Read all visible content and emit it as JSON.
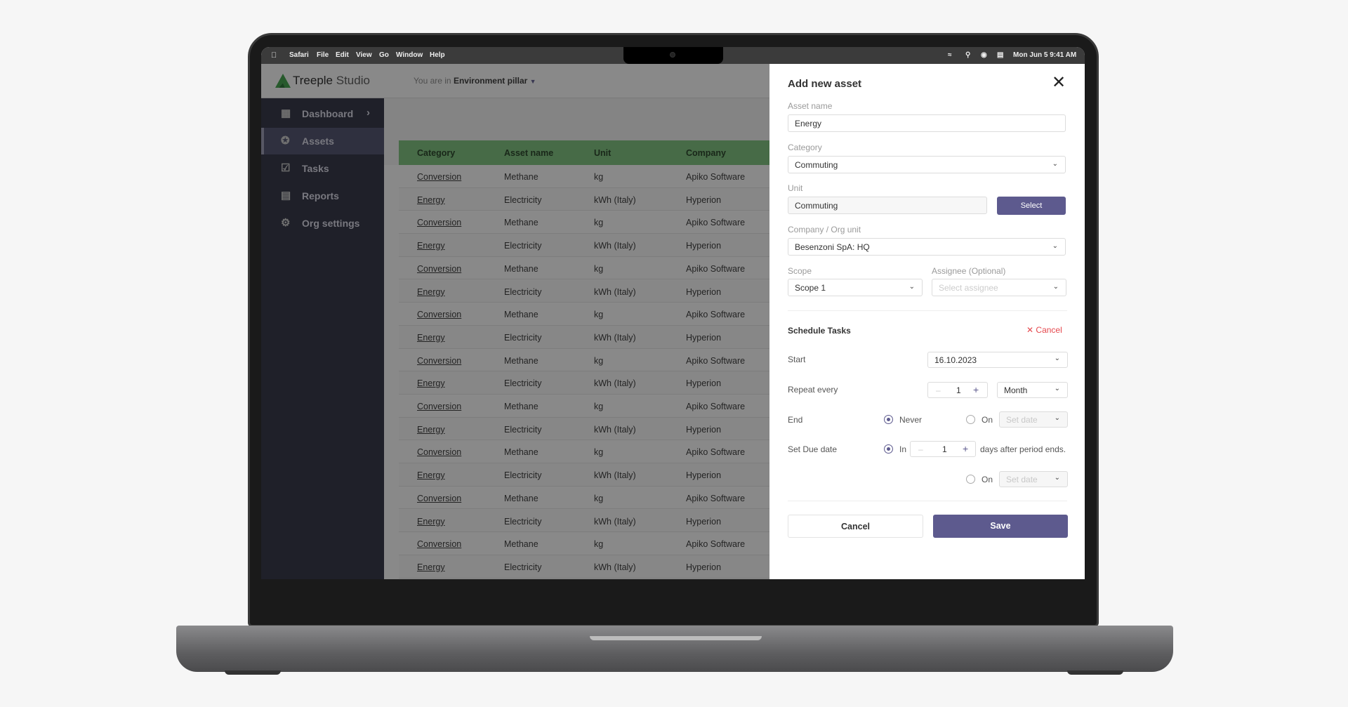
{
  "menubar": {
    "apple": "",
    "items": [
      "Safari",
      "File",
      "Edit",
      "View",
      "Go",
      "Window",
      "Help"
    ],
    "clock": "Mon Jun 5  9:41 AM"
  },
  "app": {
    "logo": "Treeple",
    "logo_suffix": "Studio",
    "context_prefix": "You are in",
    "context": "Environment pillar",
    "brand_color": "#3aa045"
  },
  "sidebar": {
    "items": [
      {
        "label": "Dashboard",
        "icon": "dashboard-icon"
      },
      {
        "label": "Assets",
        "icon": "plug-icon"
      },
      {
        "label": "Tasks",
        "icon": "clipboard-check-icon"
      },
      {
        "label": "Reports",
        "icon": "document-icon"
      },
      {
        "label": "Org settings",
        "icon": "gear-icon"
      }
    ],
    "active": "Assets"
  },
  "table": {
    "headers": [
      "Category",
      "Asset name",
      "Unit",
      "Company"
    ],
    "rows": [
      [
        "Conversion",
        "Methane",
        "kg",
        "Apiko Software"
      ],
      [
        "Energy",
        "Electricity",
        "kWh (Italy)",
        "Hyperion"
      ],
      [
        "Conversion",
        "Methane",
        "kg",
        "Apiko Software"
      ],
      [
        "Energy",
        "Electricity",
        "kWh (Italy)",
        "Hyperion"
      ],
      [
        "Conversion",
        "Methane",
        "kg",
        "Apiko Software"
      ],
      [
        "Energy",
        "Electricity",
        "kWh (Italy)",
        "Hyperion"
      ],
      [
        "Conversion",
        "Methane",
        "kg",
        "Apiko Software"
      ],
      [
        "Energy",
        "Electricity",
        "kWh (Italy)",
        "Hyperion"
      ],
      [
        "Conversion",
        "Methane",
        "kg",
        "Apiko Software"
      ],
      [
        "Energy",
        "Electricity",
        "kWh (Italy)",
        "Hyperion"
      ],
      [
        "Conversion",
        "Methane",
        "kg",
        "Apiko Software"
      ],
      [
        "Energy",
        "Electricity",
        "kWh (Italy)",
        "Hyperion"
      ],
      [
        "Conversion",
        "Methane",
        "kg",
        "Apiko Software"
      ],
      [
        "Energy",
        "Electricity",
        "kWh (Italy)",
        "Hyperion"
      ],
      [
        "Conversion",
        "Methane",
        "kg",
        "Apiko Software"
      ],
      [
        "Energy",
        "Electricity",
        "kWh (Italy)",
        "Hyperion"
      ],
      [
        "Conversion",
        "Methane",
        "kg",
        "Apiko Software"
      ],
      [
        "Energy",
        "Electricity",
        "kWh (Italy)",
        "Hyperion"
      ]
    ]
  },
  "dialog": {
    "title": "Add new asset",
    "asset_name_label": "Asset name",
    "asset_name_value": "Energy",
    "category_label": "Category",
    "category_value": "Commuting",
    "unit_label": "Unit",
    "unit_value": "Commuting",
    "select_button": "Select",
    "company_label": "Company / Org unit",
    "company_value": "Besenzoni SpA: HQ",
    "scope_label": "Scope",
    "scope_value": "Scope 1",
    "assignee_label": "Assignee (Optional)",
    "assignee_placeholder": "Select assignee",
    "schedule": {
      "title": "Schedule Tasks",
      "cancel": "Cancel",
      "start_label": "Start",
      "start_value": "16.10.2023",
      "repeat_label": "Repeat every",
      "repeat_value": "1",
      "repeat_unit": "Month",
      "end_label": "End",
      "end_never": "Never",
      "end_on": "On",
      "end_date_placeholder": "Set date",
      "end_selected": "Never",
      "due_label": "Set Due date",
      "due_in": "In",
      "due_value": "1",
      "due_suffix": "days after period ends.",
      "due_on": "On",
      "due_date_placeholder": "Set date",
      "due_selected": "In"
    },
    "cancel_button": "Cancel",
    "save_button": "Save"
  },
  "colors": {
    "primary": "#5d5a8e",
    "danger": "#e5484d",
    "table_header": "#7ac27a",
    "sidebar": "#2b2c3f"
  }
}
